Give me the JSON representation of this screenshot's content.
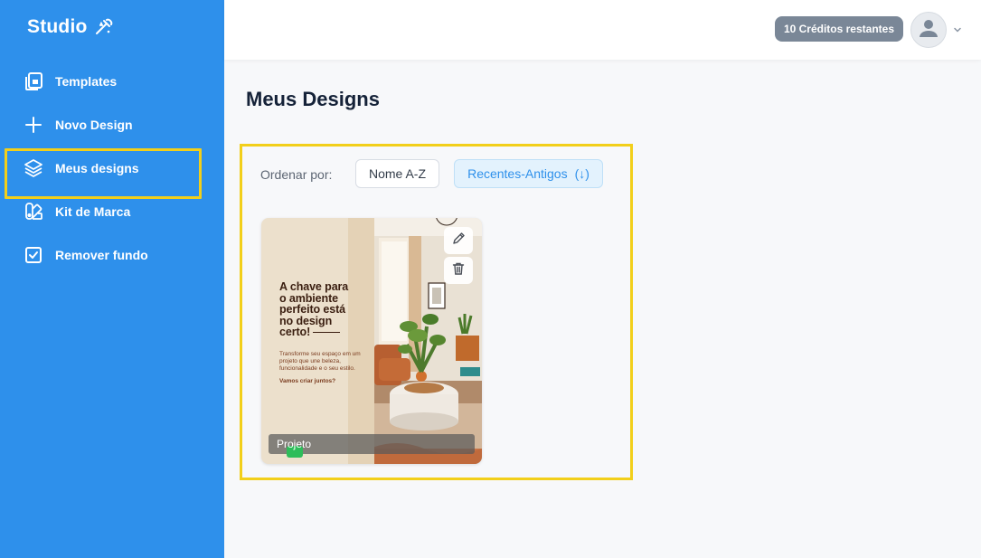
{
  "app": {
    "brand": "Studio",
    "brand_icon": "wand-icon"
  },
  "sidebar": {
    "items": [
      {
        "label": "Templates",
        "icon": "templates-icon"
      },
      {
        "label": "Novo Design",
        "icon": "plus-icon"
      },
      {
        "label": "Meus designs",
        "icon": "layers-icon"
      },
      {
        "label": "Kit de Marca",
        "icon": "brand-kit-icon"
      },
      {
        "label": "Remover fundo",
        "icon": "checkbox-icon"
      }
    ]
  },
  "header": {
    "credits": "10 Créditos restantes",
    "avatar_icon": "user-icon"
  },
  "main": {
    "title": "Meus Designs",
    "sort": {
      "label": "Ordenar por:",
      "options": [
        "Nome A-Z",
        "Recentes-Antigos"
      ],
      "direction_icon": "(↓)"
    },
    "designs": [
      {
        "name": "Projeto",
        "headline_lines": [
          "A chave para",
          "o ambiente",
          "perfeito está",
          "no design",
          "certo!"
        ],
        "body": "Transforme seu espaço em um projeto que une beleza, funcionalidade e o seu estilo.",
        "cta": "Vamos criar juntos?"
      }
    ]
  },
  "colors": {
    "sidebar": "#2e90eb",
    "highlight": "#f2cf1a",
    "credits_bg": "#7a8797",
    "accent": "#2e90eb"
  }
}
